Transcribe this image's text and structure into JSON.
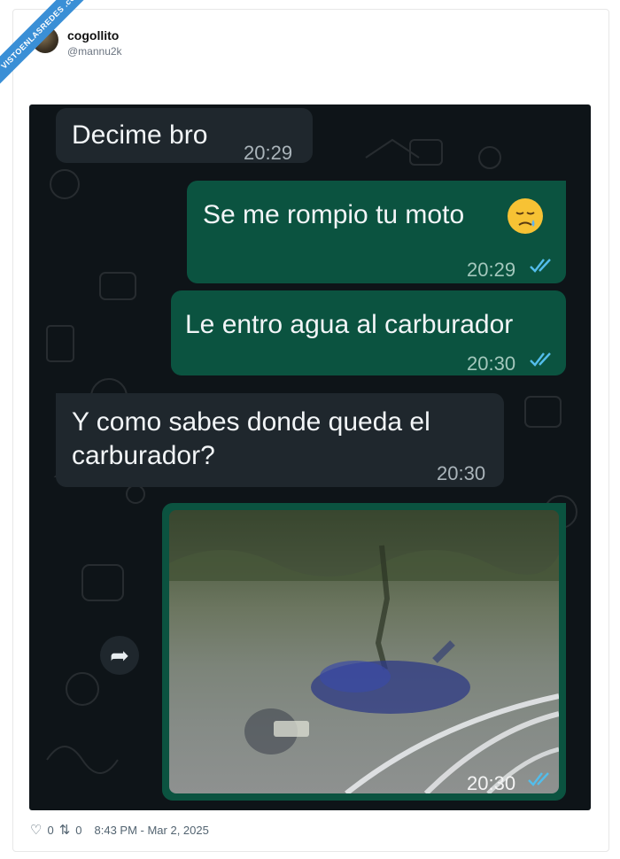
{
  "watermark": {
    "text": "VISTOENLASREDES .com"
  },
  "author": {
    "display_name": "cogollito",
    "handle": "@mannu2k"
  },
  "chat": {
    "messages": [
      {
        "direction": "incoming",
        "text": "Decime bro",
        "time": "20:29"
      },
      {
        "direction": "outgoing",
        "text": "Se me rompio tu moto",
        "emoji": "sad-sweat-face-emoji",
        "time": "20:29",
        "status": "read"
      },
      {
        "direction": "outgoing",
        "text": "Le entro agua al carburador",
        "time": "20:30",
        "status": "read"
      },
      {
        "direction": "incoming",
        "text": "Y como sabes donde queda el carburador?",
        "time": "20:30"
      },
      {
        "direction": "outgoing",
        "type": "image",
        "image": "motorcycle-submerged-in-water",
        "time": "20:30",
        "status": "read"
      }
    ],
    "forward_icon": "forward-arrow-icon",
    "bubble_colors": {
      "incoming": "#1f272d",
      "outgoing": "#0b5340",
      "background": "#0e1418"
    }
  },
  "footer": {
    "likes": "0",
    "retweets": "0",
    "timestamp": "8:43 PM - Mar 2, 2025"
  }
}
